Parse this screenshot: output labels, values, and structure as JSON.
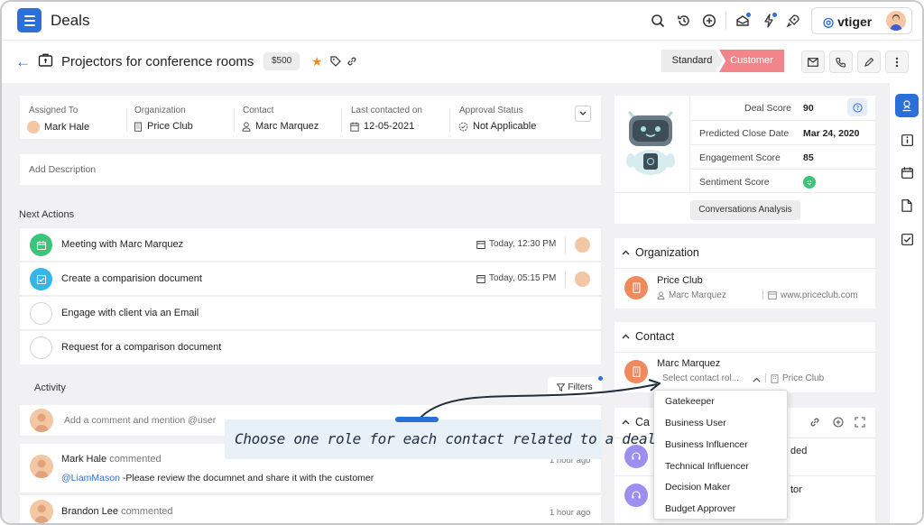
{
  "app": {
    "title": "Deals",
    "brand": "vtiger"
  },
  "record": {
    "title": "Projectors for conference rooms",
    "amount": "$500",
    "stage_standard": "Standard",
    "stage_customer": "Customer"
  },
  "fields": [
    {
      "label": "Assigned To",
      "value": "Mark Hale"
    },
    {
      "label": "Organization",
      "value": "Price Club"
    },
    {
      "label": "Contact",
      "value": "Marc Marquez"
    },
    {
      "label": "Last contacted on",
      "value": "12-05-2021"
    },
    {
      "label": "Approval Status",
      "value": "Not Applicable"
    }
  ],
  "description_placeholder": "Add Description",
  "next_actions": {
    "heading": "Next Actions",
    "items": [
      {
        "text": "Meeting with Marc Marquez",
        "time": "Today, 12:30 PM",
        "status": "done",
        "color": "#3cc47a"
      },
      {
        "text": "Create a comparision document",
        "time": "Today, 05:15 PM",
        "status": "done",
        "color": "#34b6e8"
      },
      {
        "text": "Engage with client via an Email",
        "time": "",
        "status": "open"
      },
      {
        "text": "Request for a comparison document",
        "time": "",
        "status": "open"
      }
    ]
  },
  "activity": {
    "heading": "Activity",
    "filters_label": "Filters",
    "comment_placeholder": "Add a comment and mention @user",
    "comments": [
      {
        "author": "Mark Hale",
        "verb": "commented",
        "mention": "@LiamMason",
        "text": " -Please review the documnet and share it with the customer",
        "time": "1 hour ago"
      },
      {
        "author": "Brandon Lee",
        "verb": "commented",
        "time": "1 hour ago"
      }
    ]
  },
  "scores": [
    {
      "label": "Deal Score",
      "value": "90"
    },
    {
      "label": "Predicted Close Date",
      "value": "Mar 24, 2020"
    },
    {
      "label": "Engagement Score",
      "value": "85"
    },
    {
      "label": "Sentiment Score",
      "value": ""
    }
  ],
  "conversations_label": "Conversations Analysis",
  "organization": {
    "heading": "Organization",
    "name": "Price Club",
    "owner": "Marc Marquez",
    "website": "www.priceclub.com"
  },
  "contact": {
    "heading": "Contact",
    "name": "Marc Marquez",
    "role_placeholder": "Select contact rol...",
    "org": "Price Club"
  },
  "cases": {
    "heading_partial": "Ca",
    "row1_partial": "ded",
    "row2_partial": "tor"
  },
  "role_options": [
    "Gatekeeper",
    "Business User",
    "Business Influencer",
    "Technical Influencer",
    "Decision Maker",
    "Budget Approver"
  ],
  "annotation": "Choose one role for each contact related to a deal",
  "colors": {
    "accent": "#2b6fd8",
    "customer_stage": "#f2858b",
    "star": "#f08a24",
    "org_icon": "#f08a5d",
    "case_icon": "#9b8ff0"
  }
}
